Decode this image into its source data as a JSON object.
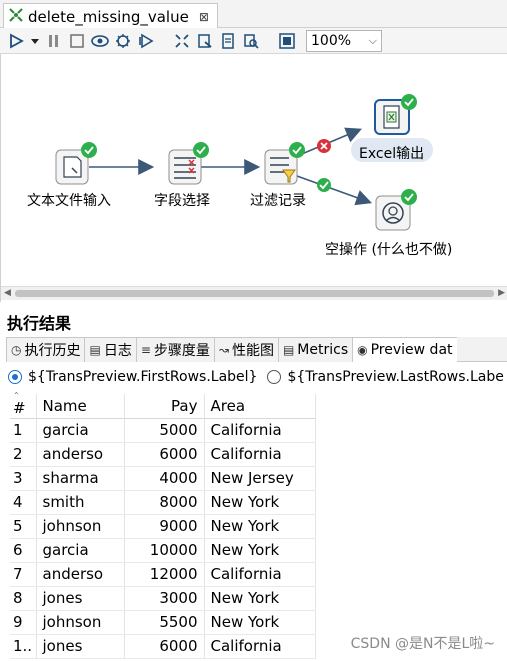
{
  "tab": {
    "title": "delete_missing_value",
    "close": "⊠"
  },
  "toolbar": {
    "buttons": [
      "run-icon",
      "dropdown-icon",
      "pause-icon",
      "stop-icon",
      "preview-icon",
      "debug-icon",
      "replay-icon",
      "verify-icon",
      "impact-icon",
      "sql-icon",
      "explore-db-icon",
      "show-results-icon"
    ],
    "zoom": "100%"
  },
  "canvas": {
    "steps": [
      {
        "label": "文本文件输入"
      },
      {
        "label": "字段选择"
      },
      {
        "label": "过滤记录"
      },
      {
        "label": "Excel输出"
      },
      {
        "label": "空操作 (什么也不做)"
      }
    ]
  },
  "results": {
    "title": "执行结果",
    "tabs": [
      "执行历史",
      "日志",
      "步骤度量",
      "性能图",
      "Metrics",
      "Preview dat"
    ],
    "radio_first": "${TransPreview.FirstRows.Label}",
    "radio_last": "${TransPreview.LastRows.Labe",
    "columns": [
      "#",
      "Name",
      "Pay",
      "Area"
    ],
    "rows": [
      {
        "idx": "1",
        "name": "garcia",
        "pay": "5000",
        "area": "California"
      },
      {
        "idx": "2",
        "name": "anderso",
        "pay": "6000",
        "area": "California"
      },
      {
        "idx": "3",
        "name": "sharma",
        "pay": "4000",
        "area": "New Jersey"
      },
      {
        "idx": "4",
        "name": "smith",
        "pay": "8000",
        "area": "New York"
      },
      {
        "idx": "5",
        "name": "johnson",
        "pay": "9000",
        "area": "New York"
      },
      {
        "idx": "6",
        "name": "garcia",
        "pay": "10000",
        "area": "New York"
      },
      {
        "idx": "7",
        "name": "anderso",
        "pay": "12000",
        "area": "California"
      },
      {
        "idx": "8",
        "name": "jones",
        "pay": "3000",
        "area": "New York"
      },
      {
        "idx": "9",
        "name": "johnson",
        "pay": "5500",
        "area": "New York"
      },
      {
        "idx": "1..",
        "name": "jones",
        "pay": "6000",
        "area": "California"
      }
    ]
  },
  "watermark": "CSDN @是N不是L啦~",
  "colors": {
    "accent_blue": "#1a6fd0",
    "ok_green": "#2db04b",
    "error_red": "#d9323a"
  }
}
